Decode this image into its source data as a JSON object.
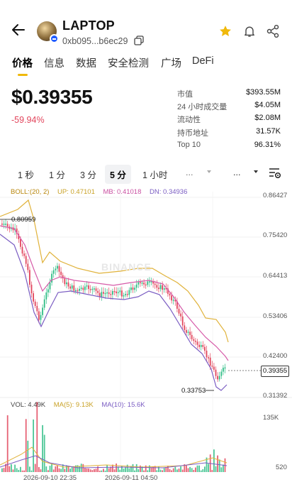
{
  "header": {
    "token_name": "LAPTOP",
    "address": "0xb095...b6ec29"
  },
  "tabs": [
    {
      "label": "价格",
      "active": true
    },
    {
      "label": "信息"
    },
    {
      "label": "数据"
    },
    {
      "label": "安全检测"
    },
    {
      "label": "广场"
    },
    {
      "label": "DeFi"
    }
  ],
  "price": {
    "current": "$0.39355",
    "change": "-59.94%"
  },
  "stats": [
    {
      "label": "市值",
      "value": "$393.55M"
    },
    {
      "label": "24 小时成交量",
      "value": "$4.05M"
    },
    {
      "label": "流动性",
      "value": "$2.08M"
    },
    {
      "label": "持币地址",
      "value": "31.57K"
    },
    {
      "label": "Top 10",
      "value": "96.31%"
    }
  ],
  "intervals": [
    "1 秒",
    "1 分",
    "3 分",
    "5 分",
    "1 小时",
    "...",
    "..."
  ],
  "indicators": {
    "boll": "BOLL:(20, 2)",
    "up": "UP: 0.47101",
    "mb": "MB: 0.41018",
    "dn": "DN: 0.34936",
    "vol": "VOL: 4.49K",
    "ma5": "MA(5): 9.13K",
    "ma10": "MA(10): 15.6K"
  },
  "chart": {
    "y_axis": [
      "0.86427",
      "0.75420",
      "0.64413",
      "0.53406",
      "0.42400",
      "0.31392"
    ],
    "vol_axis": [
      "135K",
      "520"
    ],
    "current_tag": "0.39355",
    "high_label": "0.80959",
    "low_label": "0.33753",
    "times": [
      "2026-09-10 22:35",
      "2026-09-11 04:50"
    ],
    "watermark": "BINANCE"
  },
  "colors": {
    "accent": "#f0b90b",
    "down": "#e2455c",
    "up": "#2ebd85",
    "boll_up": "#e0b23a",
    "boll_mb": "#d65aa8",
    "boll_dn": "#7a5cc2"
  }
}
